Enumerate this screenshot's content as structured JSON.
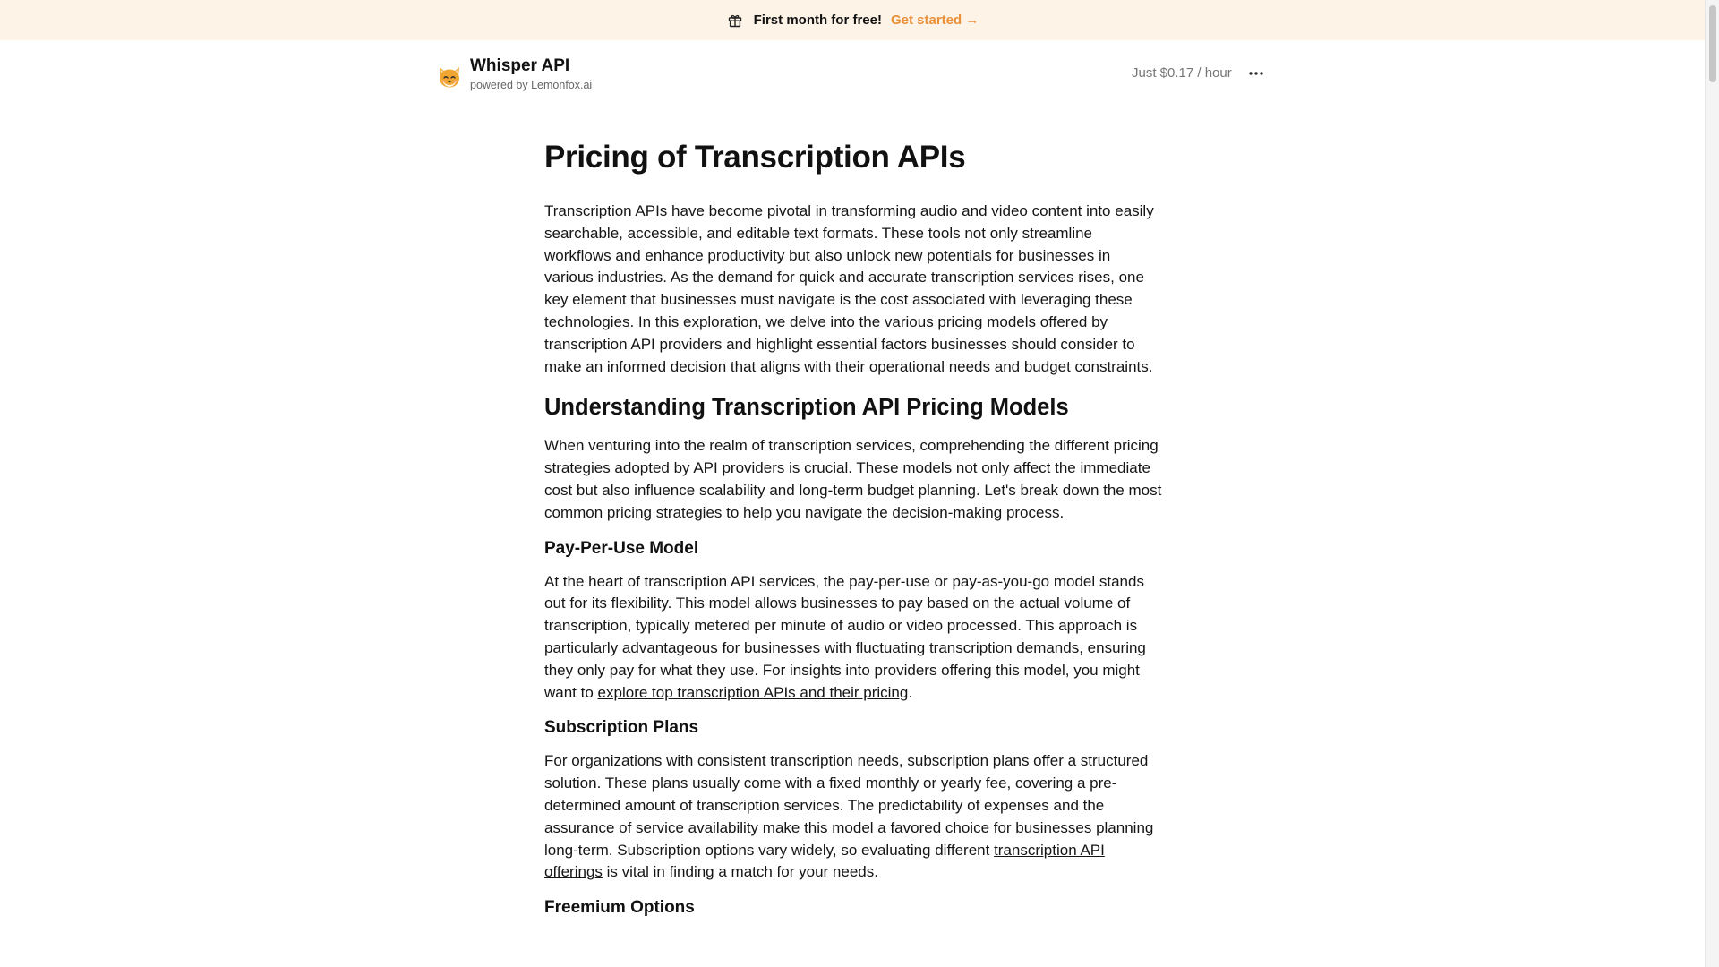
{
  "banner": {
    "icon": "gift-icon",
    "text": "First month for free!",
    "cta_label": "Get started →",
    "cta_color": "#e8903a",
    "background": "#fdf3e7"
  },
  "header": {
    "brand_title": "Whisper API",
    "brand_subtitle": "powered by Lemonfox.ai",
    "price_note": "Just $0.17 / hour",
    "more_icon": "more-horizontal-icon"
  },
  "article": {
    "title": "Pricing of Transcription APIs",
    "intro": "Transcription APIs have become pivotal in transforming audio and video content into easily searchable, accessible, and editable text formats. These tools not only streamline workflows and enhance productivity but also unlock new potentials for businesses in various industries. As the demand for quick and accurate transcription services rises, one key element that businesses must navigate is the cost associated with leveraging these technologies. In this exploration, we delve into the various pricing models offered by transcription API providers and highlight essential factors businesses should consider to make an informed decision that aligns with their operational needs and budget constraints.",
    "section1": {
      "heading": "Understanding Transcription API Pricing Models",
      "body": "When venturing into the realm of transcription services, comprehending the different pricing strategies adopted by API providers is crucial. These models not only affect the immediate cost but also influence scalability and long-term budget planning. Let's break down the most common pricing strategies to help you navigate the decision-making process."
    },
    "pay_per_use": {
      "heading": "Pay-Per-Use Model",
      "body_before": "At the heart of transcription API services, the pay-per-use or pay-as-you-go model stands out for its flexibility. This model allows businesses to pay based on the actual volume of transcription, typically metered per minute of audio or video processed. This approach is particularly advantageous for businesses with fluctuating transcription demands, ensuring they only pay for what they use. For insights into providers offering this model, you might want to ",
      "link": "explore top transcription APIs and their pricing",
      "body_after": "."
    },
    "subscription": {
      "heading": "Subscription Plans",
      "body_before": "For organizations with consistent transcription needs, subscription plans offer a structured solution. These plans usually come with a fixed monthly or yearly fee, covering a pre-determined amount of transcription services. The predictability of expenses and the assurance of service availability make this model a favored choice for businesses planning long-term. Subscription options vary widely, so evaluating different ",
      "link": "transcription API offerings",
      "body_after": " is vital in finding a match for your needs."
    },
    "freemium": {
      "heading": "Freemium Options"
    }
  }
}
